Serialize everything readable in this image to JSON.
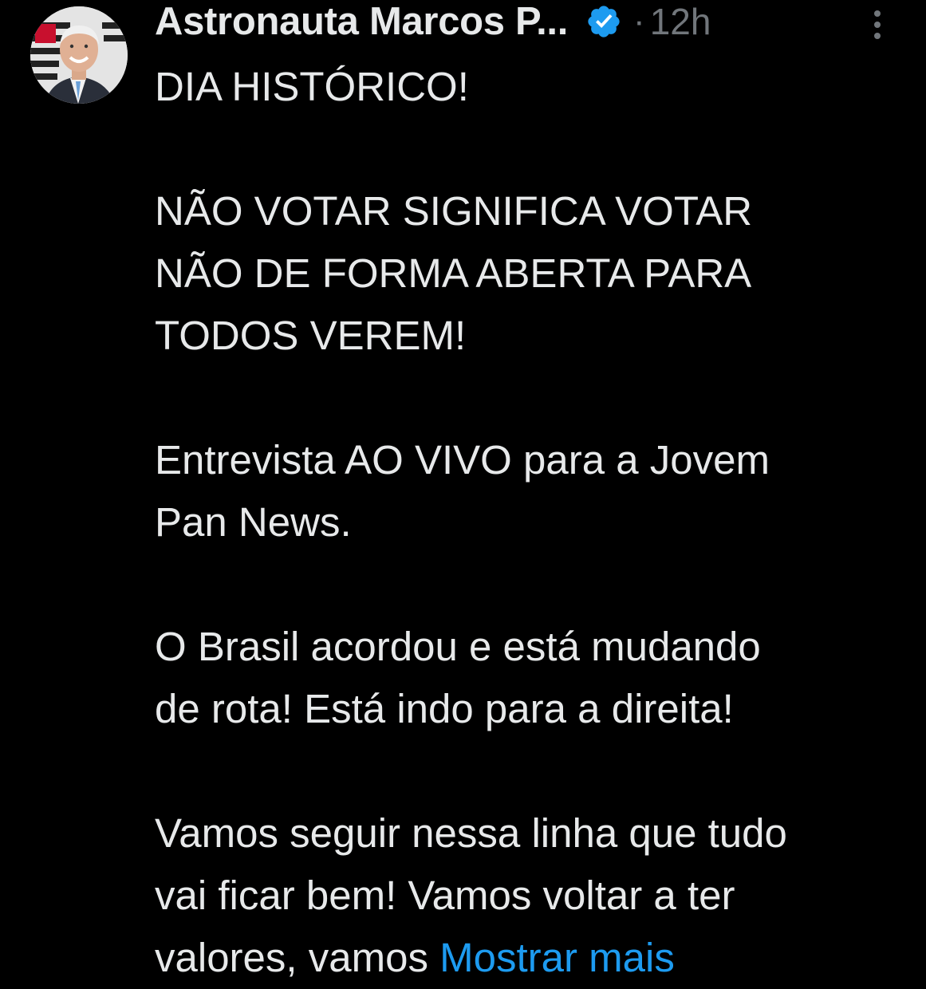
{
  "author": {
    "name": "Astronauta Marcos P...",
    "verified_icon": "verified-badge-icon",
    "timestamp": "12h",
    "separator": "·"
  },
  "menu": {
    "icon": "more-vertical-icon"
  },
  "colors": {
    "background": "#000000",
    "text": "#e7e9ea",
    "muted": "#71767b",
    "link": "#1d9bf0",
    "verified": "#1d9bf0"
  },
  "tweet": {
    "lines": [
      "DIA HISTÓRICO!",
      "",
      "NÃO VOTAR SIGNIFICA VOTAR",
      "NÃO DE FORMA ABERTA PARA",
      "TODOS VEREM!",
      "",
      "Entrevista AO VIVO para a Jovem",
      "Pan News.",
      "",
      "O Brasil acordou e está mudando",
      "de rota! Está indo para a direita!",
      "",
      "Vamos seguir nessa linha que tudo",
      "vai ficar bem! Vamos voltar a ter"
    ],
    "last_line": "valores, vamos ",
    "show_more": "Mostrar mais"
  }
}
